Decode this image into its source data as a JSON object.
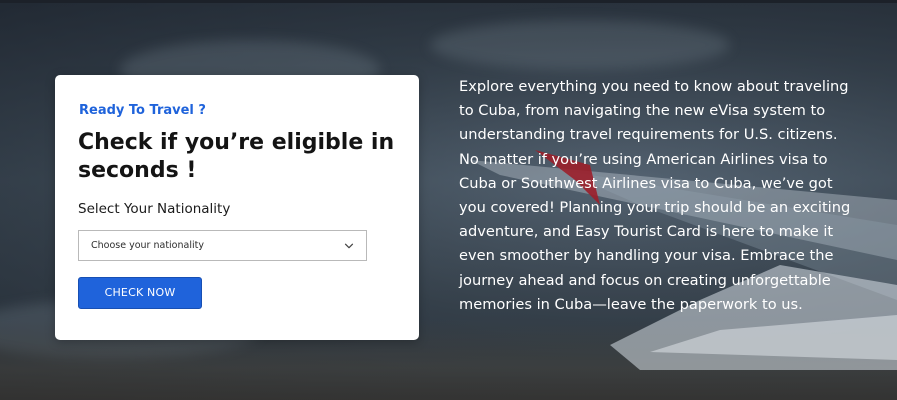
{
  "eligibility_card": {
    "eyebrow": "Ready To Travel ?",
    "headline": "Check if you’re eligible in seconds !",
    "nationality_label": "Select Your Nationality",
    "nationality_select": {
      "selected_text": "Choose your nationality"
    },
    "cta_label": "CHECK NOW"
  },
  "description": {
    "text": "Explore everything you need to know about traveling to Cuba, from navigating the new eVisa system to understanding travel requirements for U.S. citizens. No matter if you’re using American Airlines visa to Cuba or Southwest Airlines visa to Cuba, we’ve got you covered! Planning your trip should be an exciting adventure, and Easy Tourist Card is here to make it even smoother by handling your visa. Embrace the journey ahead and focus on creating unforgettable memories in Cuba—leave the paperwork to us."
  },
  "icons": {
    "select_chevron": "chevron-down-icon"
  },
  "colors": {
    "accent": "#1f63db",
    "card_background": "#ffffff",
    "headline_text": "#141414",
    "description_text": "#ffffff"
  }
}
